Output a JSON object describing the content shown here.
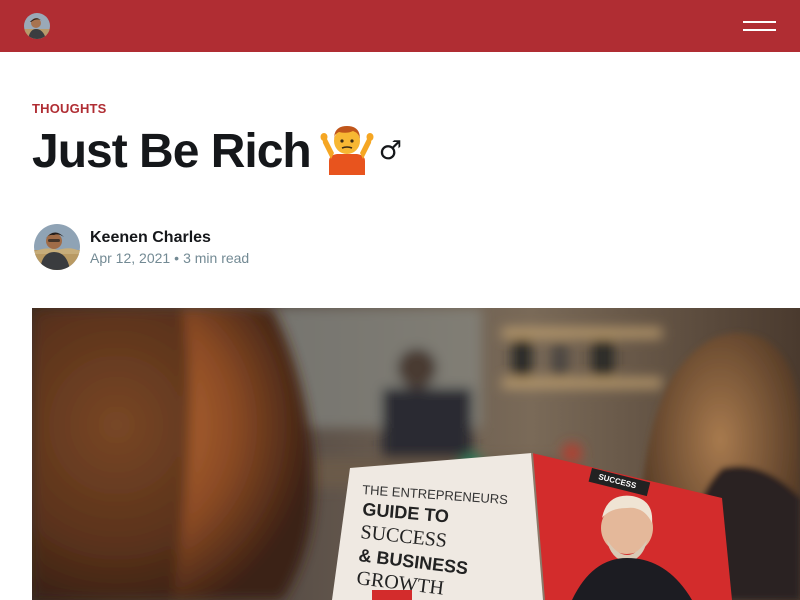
{
  "header": {
    "logo_alt": "Keenen Charles",
    "menu_label": "Menu"
  },
  "article": {
    "tag": "Thoughts",
    "title": "Just Be Rich",
    "title_emoji": "🤷",
    "title_suffix": "♂",
    "author": {
      "name": "Keenen Charles",
      "date": "Apr 12, 2021",
      "separator": "•",
      "reading_time": "3 min read"
    },
    "feature_image": {
      "magazine_line1": "THE ENTREPRENEURS",
      "magazine_line2": "GUIDE TO",
      "magazine_line3": "SUCCESS",
      "magazine_line4": "& BUSINESS",
      "magazine_line5": "GROWTH",
      "magazine_tag": "SUCCESS"
    }
  },
  "colors": {
    "brand": "#b02d33",
    "text": "#15171a",
    "meta": "#738a94"
  }
}
